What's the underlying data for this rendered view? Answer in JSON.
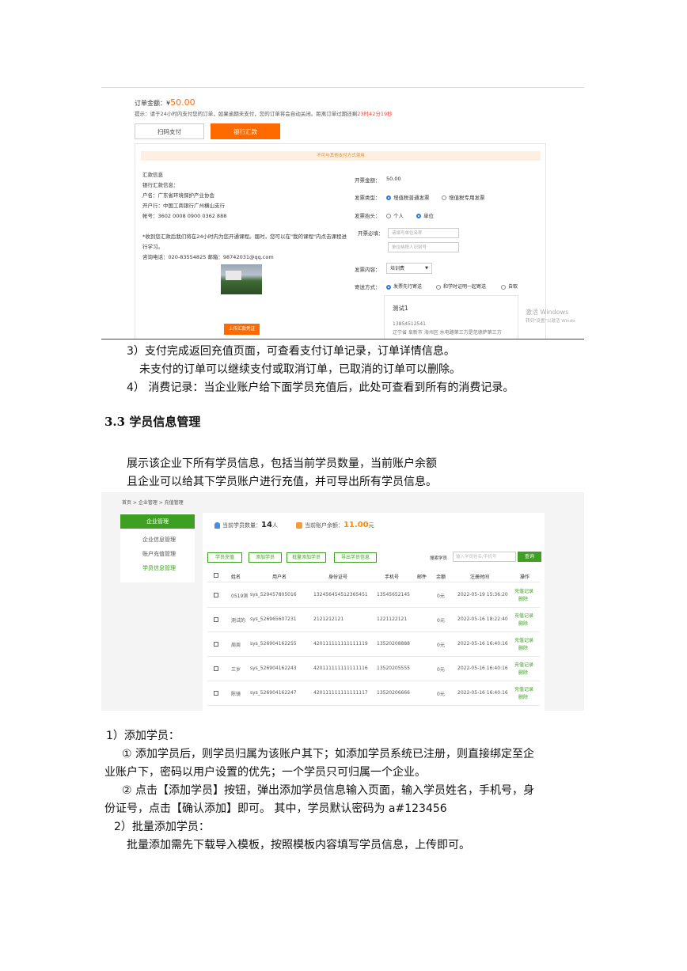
{
  "payment": {
    "amount_label": "订单金额：¥",
    "amount_value": "50.00",
    "notice_prefix": "提示：请于24小时内支付您的订单，如果逾期未支付，您的订单将会自动关闭。距离订单过期还剩",
    "notice_countdown": "23时42分19秒",
    "tab_scan": "扫码支付",
    "tab_bank": "银行汇款",
    "bank_notice": "不可与其他支付方式混用",
    "bank_lines": [
      "汇款信息",
      "银行汇款信息：",
      "户名：广东省环境保护产业协会",
      "开户行：中国工商银行广州横山支行",
      "帐号：3602 0008 0900 0362 888",
      "",
      "*收到您汇款后我们将在24小时内为您开通课程。届时，您可以在\"我的课程\"内点击课程进",
      "行学习。",
      "咨询电话：020-83554825 邮箱：98742031@qq.com"
    ],
    "upload_button": "上传汇款凭证",
    "invoice_amount_label": "开票金额：",
    "invoice_amount_value": "50.00",
    "invoice_type_label": "发票类型：",
    "invoice_type_options": [
      "增值税普通发票",
      "增值税专用发票"
    ],
    "invoice_title_label": "发票抬头：",
    "invoice_title_options": [
      "个人",
      "单位"
    ],
    "invoice_required_label": "开票必填：",
    "company_name_placeholder": "请填写单位名称",
    "tax_id_placeholder": "单位纳税人识别号",
    "invoice_content_label": "发票内容：",
    "invoice_content_value": "培训费",
    "delivery_label": "寄送方式：",
    "delivery_options": [
      "发票先行寄送",
      "和学时证明一起寄送",
      "自取"
    ],
    "address_name": "测试1",
    "address_phone": "13854512541",
    "address_line": "辽宁省  阜新市  海州区  水电路第三方是范德萨第三方",
    "watermark_title": "激活 Windows",
    "watermark_sub": "转到\"设置\"以激活 Windo"
  },
  "text": {
    "p1": "3）支付完成返回充值页面，可查看支付订单记录，订单详情信息。",
    "p2": "未支付的订单可以继续支付或取消订单，已取消的订单可以删除。",
    "p3": "4） 消费记录：当企业账户给下面学员充值后，此处可查看到所有的消费记录。",
    "heading": "3.3 学员信息管理",
    "p4": "展示该企业下所有学员信息，包括当前学员数量，当前账户余额",
    "p5": "且企业可以给其下学员账户进行充值，并可导出所有学员信息。",
    "p6": "1）添加学员：",
    "p7a": "① 添加学员后，则学员归属为该账户其下；如添加学员系统已注册，则直接绑定至企",
    "p7b": "业账户下，密码以用户设置的优先；一个学员只可归属一个企业。",
    "p8a": "② 点击【添加学员】按钮，弹出添加学员信息输入页面，输入学员姓名，手机号，身",
    "p8b": "份证号，点击【确认添加】即可。 其中，学员默认密码为 a#123456",
    "p9": "2）批量添加学员：",
    "p10": "批量添加需先下载导入模板，按照模板内容填写学员信息，上传即可。"
  },
  "students": {
    "breadcrumb": "首页 > 企业管理 > 充值管理",
    "side_title": "企业管理",
    "side_items": [
      "企业信息管理",
      "账户充值管理",
      "学员信息管理"
    ],
    "count_label": "当前学员数量：",
    "count_value": "14",
    "count_unit": "人",
    "balance_label": "当前账户余额：",
    "balance_value": "11.00",
    "balance_unit": "元",
    "buttons": [
      "学员充值",
      "添加学员",
      "批量添加学员",
      "导出学员信息"
    ],
    "search_label": "搜索学员",
    "search_placeholder": "输入学员姓名/手机号",
    "search_button": "查询",
    "headers": [
      "姓名",
      "用户名",
      "身份证号",
      "手机号",
      "邮件",
      "余额",
      "注册时间",
      "操作"
    ],
    "op_recharge": "充值记录",
    "op_delete": "删除",
    "rows": [
      {
        "name": "0519测",
        "username": "sys_529457805016",
        "id": "132456454512365451",
        "phone": "13545652145",
        "balance": "0元",
        "time": "2022-05-19 15:36:20"
      },
      {
        "name": "测试的",
        "username": "sys_526965607231",
        "id": "2121212121",
        "phone": "1221122121",
        "balance": "0元",
        "time": "2022-05-16 18:22:40"
      },
      {
        "name": "周周",
        "username": "sys_526904162255",
        "id": "420111111111111119",
        "phone": "13520208888",
        "balance": "0元",
        "time": "2022-05-16 16:40:16"
      },
      {
        "name": "三岁",
        "username": "sys_526904162243",
        "id": "420111111111111116",
        "phone": "13520205555",
        "balance": "0元",
        "time": "2022-05-16 16:40:16"
      },
      {
        "name": "陈镜",
        "username": "sys_526904162247",
        "id": "420111111111111117",
        "phone": "13520206666",
        "balance": "0元",
        "time": "2022-05-16 16:40:16"
      }
    ]
  }
}
